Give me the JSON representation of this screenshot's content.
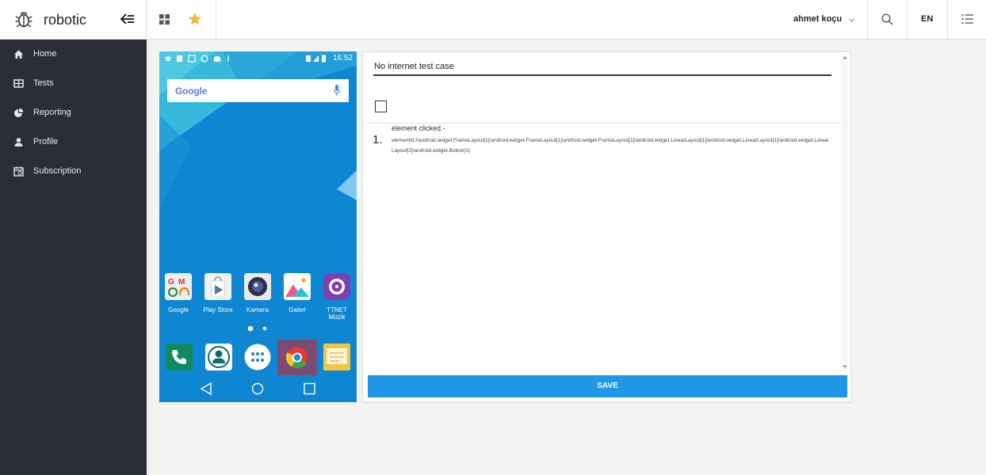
{
  "brand": {
    "name": "robotic",
    "logo_icon": "bug-icon",
    "collapse_icon": "arrow-collapse-icon"
  },
  "sidebar": {
    "items": [
      {
        "label": "Home",
        "icon": "home-icon"
      },
      {
        "label": "Tests",
        "icon": "table-icon"
      },
      {
        "label": "Reporting",
        "icon": "pie-chart-icon"
      },
      {
        "label": "Profile",
        "icon": "user-icon"
      },
      {
        "label": "Subscription",
        "icon": "calendar-icon"
      }
    ]
  },
  "header": {
    "grid_icon": "grid-icon",
    "star_icon": "star-icon",
    "user": "ahmet koçu",
    "language": "EN",
    "search_icon": "search-icon",
    "menu_icon": "list-icon"
  },
  "phone": {
    "time": "16:52",
    "search_logo": "Google",
    "apps": [
      {
        "label": "Google"
      },
      {
        "label": "Play Store"
      },
      {
        "label": "Kamera"
      },
      {
        "label": "Galeri"
      },
      {
        "label": "TTNET Müzik"
      }
    ]
  },
  "editor": {
    "test_case_name": "No internet test case",
    "checked": false,
    "steps": [
      {
        "number": "1.",
        "title": "element clicked.-",
        "detail": "elementId://android.widget.FrameLayout[1]/android.widget.FrameLayout[1]/android.widget.FrameLayout[1]/android.widget.LinearLayout[1]/android.widget.LinearLayout[1]/android.widget.LinearLayout[2]/android.widget.Button[1]"
      }
    ],
    "save_label": "SAVE"
  },
  "colors": {
    "sidebar_bg": "#2b2e38",
    "accent": "#1e97e4",
    "star": "#f5b82e",
    "phone_bg": "#0f86d1"
  }
}
